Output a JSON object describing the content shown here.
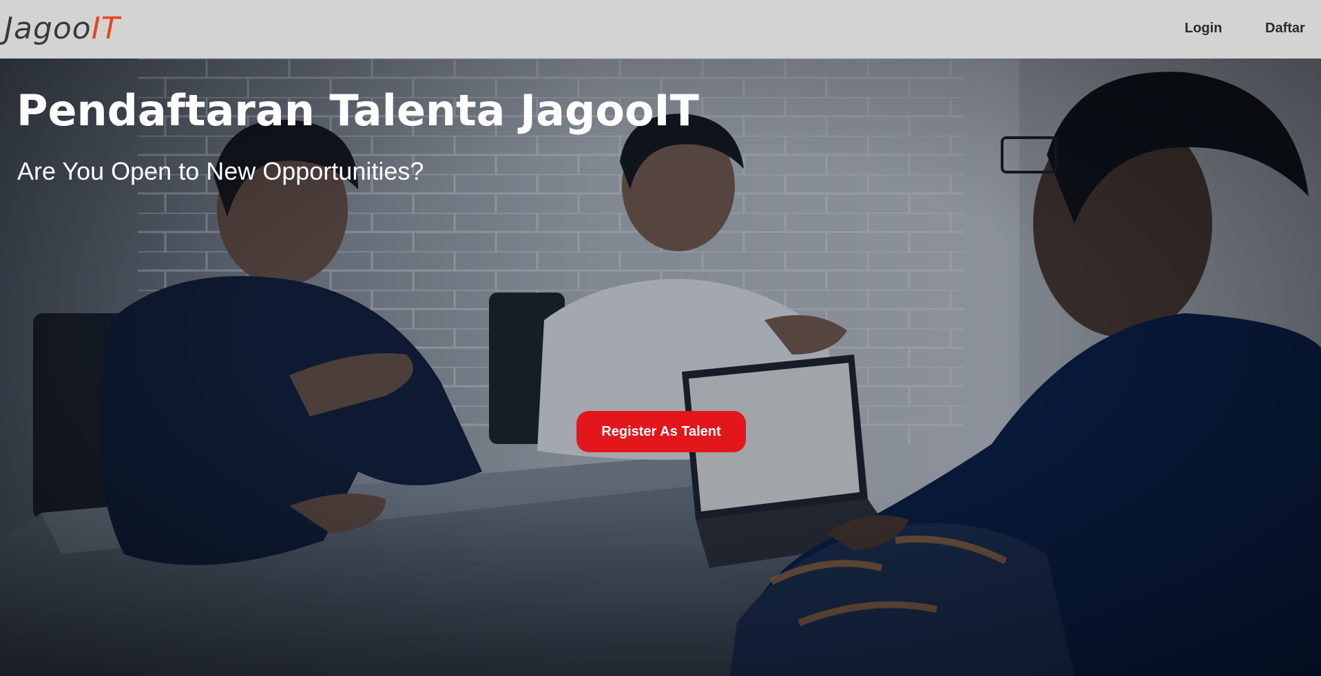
{
  "navbar": {
    "logo": {
      "main": "Jagoo",
      "accent": "IT"
    },
    "links": {
      "login": "Login",
      "daftar": "Daftar"
    }
  },
  "hero": {
    "title": "Pendaftaran Talenta JagooIT",
    "subtitle": "Are You Open to New Opportunities?",
    "cta_label": "Register As Talent",
    "background": "photo-of-people-meeting-at-table"
  },
  "colors": {
    "navbar_bg": "#d3d3d3",
    "logo_text": "#3a3a3a",
    "logo_accent": "#e8461f",
    "cta_bg": "#e3161c",
    "hero_text": "#ffffff"
  }
}
